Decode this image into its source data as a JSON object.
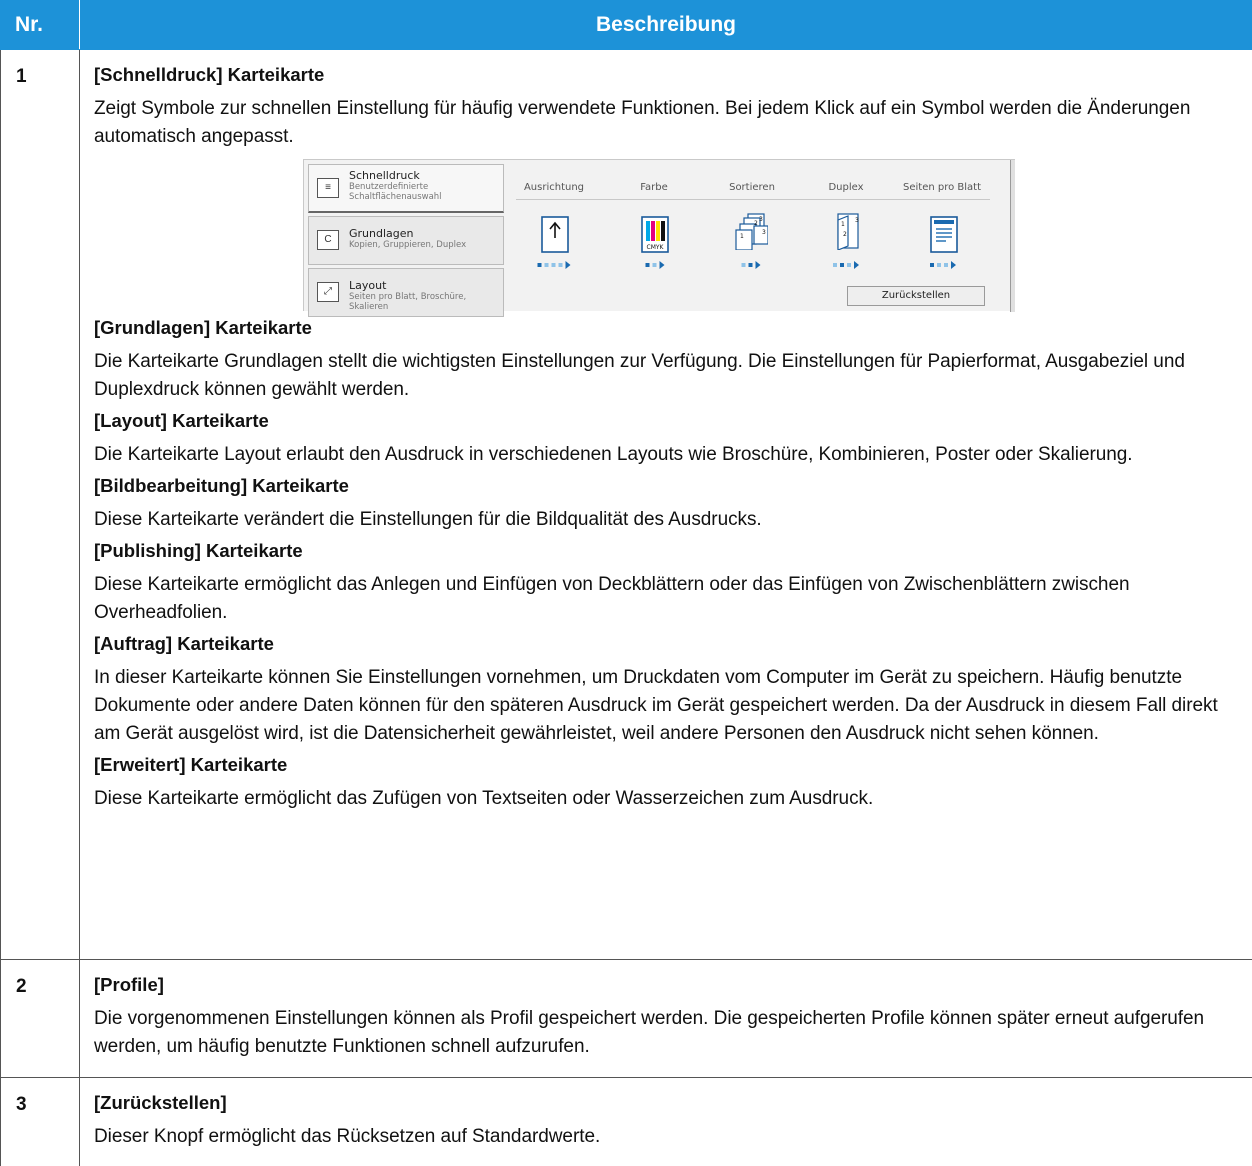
{
  "table": {
    "col_nr": "Nr.",
    "col_desc": "Beschreibung"
  },
  "rows": [
    {
      "number": "1",
      "sections": [
        {
          "heading": "[Schnelldruck] Karteikarte",
          "text": "Zeigt Symbole zur schnellen Einstellung für häufig verwendete Funktionen. Bei jedem Klick auf ein Symbol werden die Änderungen automatisch angepasst."
        },
        {
          "heading": "[Grundlagen] Karteikarte",
          "text": "Die Karteikarte Grundlagen stellt die wichtigsten Einstellungen zur Verfügung. Die Einstellungen für Papierformat, Ausgabeziel und Duplexdruck können gewählt werden."
        },
        {
          "heading": "[Layout] Karteikarte",
          "text": "Die Karteikarte Layout erlaubt den Ausdruck in verschiedenen Layouts wie Broschüre, Kombinieren, Poster oder Skalierung."
        },
        {
          "heading": "[Bildbearbeitung] Karteikarte",
          "text": "Diese Karteikarte verändert die Einstellungen für die Bildqualität des Ausdrucks."
        },
        {
          "heading": "[Publishing] Karteikarte",
          "text": "Diese Karteikarte ermöglicht das Anlegen und Einfügen von Deckblättern oder das Einfügen von Zwischenblättern zwischen Overheadfolien."
        },
        {
          "heading": "[Auftrag] Karteikarte",
          "text": "In dieser Karteikarte können Sie Einstellungen vornehmen, um Druckdaten vom Computer im Gerät zu speichern. Häufig benutzte Dokumente oder andere Daten können für den späteren Ausdruck im Gerät gespeichert werden. Da der Ausdruck in diesem Fall direkt am Gerät ausgelöst wird, ist die Datensicherheit gewährleistet, weil andere Personen den Ausdruck nicht sehen können."
        },
        {
          "heading": "[Erweitert] Karteikarte",
          "text": "Diese Karteikarte ermöglicht das Zufügen von Textseiten oder Wasserzeichen zum Ausdruck."
        }
      ]
    },
    {
      "number": "2",
      "heading": "[Profile]",
      "text": "Die vorgenommenen Einstellungen können als Profil gespeichert werden. Die gespeicherten Profile können später erneut aufgerufen werden, um häufig benutzte Funktionen schnell aufzurufen."
    },
    {
      "number": "3",
      "heading": "[Zurückstellen]",
      "text": "Dieser Knopf ermöglicht das Rücksetzen auf Standardwerte."
    }
  ],
  "screenshot": {
    "tabs": [
      {
        "title": "Schnelldruck",
        "subtitle": "Benutzerdefinierte Schaltflächenauswahl",
        "subtitle2": "Schaltflächenauswahl"
      },
      {
        "title": "Grundlagen",
        "subtitle": "Kopien, Gruppieren, Duplex"
      },
      {
        "title": "Layout",
        "subtitle": "Seiten pro Blatt, Broschüre, Skalieren"
      }
    ],
    "tab1_sub_a": "Benutzerdefinierte",
    "quick_labels": [
      "Ausrichtung",
      "Farbe",
      "Sortieren",
      "Duplex",
      "Seiten pro Blatt"
    ],
    "cmyk": "CMYK",
    "reset_button": "Zurückstellen",
    "icon_names": [
      "portrait-orientation-icon",
      "color-cmyk-icon",
      "collate-icon",
      "duplex-icon",
      "pages-per-sheet-icon"
    ]
  }
}
